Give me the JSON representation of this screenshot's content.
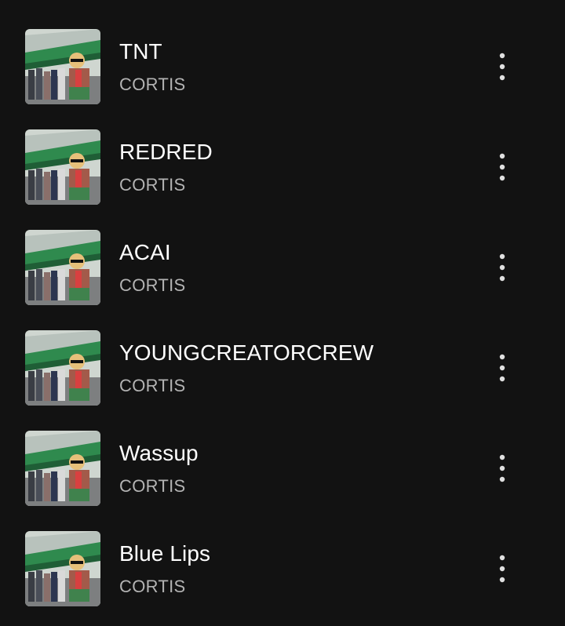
{
  "tracks": [
    {
      "title": "TNT",
      "artist": "CORTIS",
      "menu_icon": "more-vertical-icon",
      "cover_icon": "album-cover"
    },
    {
      "title": "REDRED",
      "artist": "CORTIS",
      "menu_icon": "more-vertical-icon",
      "cover_icon": "album-cover"
    },
    {
      "title": "ACAI",
      "artist": "CORTIS",
      "menu_icon": "more-vertical-icon",
      "cover_icon": "album-cover"
    },
    {
      "title": "YOUNGCREATORCREW",
      "artist": "CORTIS",
      "menu_icon": "more-vertical-icon",
      "cover_icon": "album-cover"
    },
    {
      "title": "Wassup",
      "artist": "CORTIS",
      "menu_icon": "more-vertical-icon",
      "cover_icon": "album-cover"
    },
    {
      "title": "Blue Lips",
      "artist": "CORTIS",
      "menu_icon": "more-vertical-icon",
      "cover_icon": "album-cover"
    }
  ],
  "colors": {
    "background": "#121212",
    "title_text": "#ffffff",
    "artist_text": "#b3b3b3",
    "menu_dots": "#e0e0e0",
    "cover_green_band": "#2f8a4e"
  }
}
